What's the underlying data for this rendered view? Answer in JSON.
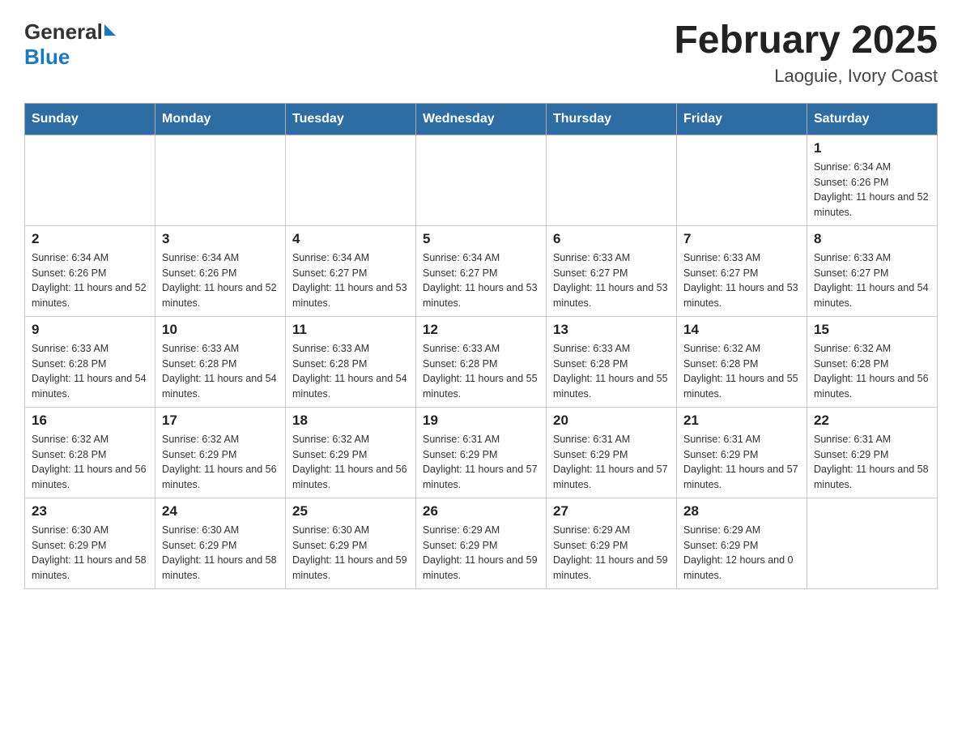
{
  "header": {
    "logo_general": "General",
    "logo_blue": "Blue",
    "title": "February 2025",
    "subtitle": "Laoguie, Ivory Coast"
  },
  "days_of_week": [
    "Sunday",
    "Monday",
    "Tuesday",
    "Wednesday",
    "Thursday",
    "Friday",
    "Saturday"
  ],
  "weeks": [
    [
      {
        "day": "",
        "info": ""
      },
      {
        "day": "",
        "info": ""
      },
      {
        "day": "",
        "info": ""
      },
      {
        "day": "",
        "info": ""
      },
      {
        "day": "",
        "info": ""
      },
      {
        "day": "",
        "info": ""
      },
      {
        "day": "1",
        "info": "Sunrise: 6:34 AM\nSunset: 6:26 PM\nDaylight: 11 hours and 52 minutes."
      }
    ],
    [
      {
        "day": "2",
        "info": "Sunrise: 6:34 AM\nSunset: 6:26 PM\nDaylight: 11 hours and 52 minutes."
      },
      {
        "day": "3",
        "info": "Sunrise: 6:34 AM\nSunset: 6:26 PM\nDaylight: 11 hours and 52 minutes."
      },
      {
        "day": "4",
        "info": "Sunrise: 6:34 AM\nSunset: 6:27 PM\nDaylight: 11 hours and 53 minutes."
      },
      {
        "day": "5",
        "info": "Sunrise: 6:34 AM\nSunset: 6:27 PM\nDaylight: 11 hours and 53 minutes."
      },
      {
        "day": "6",
        "info": "Sunrise: 6:33 AM\nSunset: 6:27 PM\nDaylight: 11 hours and 53 minutes."
      },
      {
        "day": "7",
        "info": "Sunrise: 6:33 AM\nSunset: 6:27 PM\nDaylight: 11 hours and 53 minutes."
      },
      {
        "day": "8",
        "info": "Sunrise: 6:33 AM\nSunset: 6:27 PM\nDaylight: 11 hours and 54 minutes."
      }
    ],
    [
      {
        "day": "9",
        "info": "Sunrise: 6:33 AM\nSunset: 6:28 PM\nDaylight: 11 hours and 54 minutes."
      },
      {
        "day": "10",
        "info": "Sunrise: 6:33 AM\nSunset: 6:28 PM\nDaylight: 11 hours and 54 minutes."
      },
      {
        "day": "11",
        "info": "Sunrise: 6:33 AM\nSunset: 6:28 PM\nDaylight: 11 hours and 54 minutes."
      },
      {
        "day": "12",
        "info": "Sunrise: 6:33 AM\nSunset: 6:28 PM\nDaylight: 11 hours and 55 minutes."
      },
      {
        "day": "13",
        "info": "Sunrise: 6:33 AM\nSunset: 6:28 PM\nDaylight: 11 hours and 55 minutes."
      },
      {
        "day": "14",
        "info": "Sunrise: 6:32 AM\nSunset: 6:28 PM\nDaylight: 11 hours and 55 minutes."
      },
      {
        "day": "15",
        "info": "Sunrise: 6:32 AM\nSunset: 6:28 PM\nDaylight: 11 hours and 56 minutes."
      }
    ],
    [
      {
        "day": "16",
        "info": "Sunrise: 6:32 AM\nSunset: 6:28 PM\nDaylight: 11 hours and 56 minutes."
      },
      {
        "day": "17",
        "info": "Sunrise: 6:32 AM\nSunset: 6:29 PM\nDaylight: 11 hours and 56 minutes."
      },
      {
        "day": "18",
        "info": "Sunrise: 6:32 AM\nSunset: 6:29 PM\nDaylight: 11 hours and 56 minutes."
      },
      {
        "day": "19",
        "info": "Sunrise: 6:31 AM\nSunset: 6:29 PM\nDaylight: 11 hours and 57 minutes."
      },
      {
        "day": "20",
        "info": "Sunrise: 6:31 AM\nSunset: 6:29 PM\nDaylight: 11 hours and 57 minutes."
      },
      {
        "day": "21",
        "info": "Sunrise: 6:31 AM\nSunset: 6:29 PM\nDaylight: 11 hours and 57 minutes."
      },
      {
        "day": "22",
        "info": "Sunrise: 6:31 AM\nSunset: 6:29 PM\nDaylight: 11 hours and 58 minutes."
      }
    ],
    [
      {
        "day": "23",
        "info": "Sunrise: 6:30 AM\nSunset: 6:29 PM\nDaylight: 11 hours and 58 minutes."
      },
      {
        "day": "24",
        "info": "Sunrise: 6:30 AM\nSunset: 6:29 PM\nDaylight: 11 hours and 58 minutes."
      },
      {
        "day": "25",
        "info": "Sunrise: 6:30 AM\nSunset: 6:29 PM\nDaylight: 11 hours and 59 minutes."
      },
      {
        "day": "26",
        "info": "Sunrise: 6:29 AM\nSunset: 6:29 PM\nDaylight: 11 hours and 59 minutes."
      },
      {
        "day": "27",
        "info": "Sunrise: 6:29 AM\nSunset: 6:29 PM\nDaylight: 11 hours and 59 minutes."
      },
      {
        "day": "28",
        "info": "Sunrise: 6:29 AM\nSunset: 6:29 PM\nDaylight: 12 hours and 0 minutes."
      },
      {
        "day": "",
        "info": ""
      }
    ]
  ]
}
